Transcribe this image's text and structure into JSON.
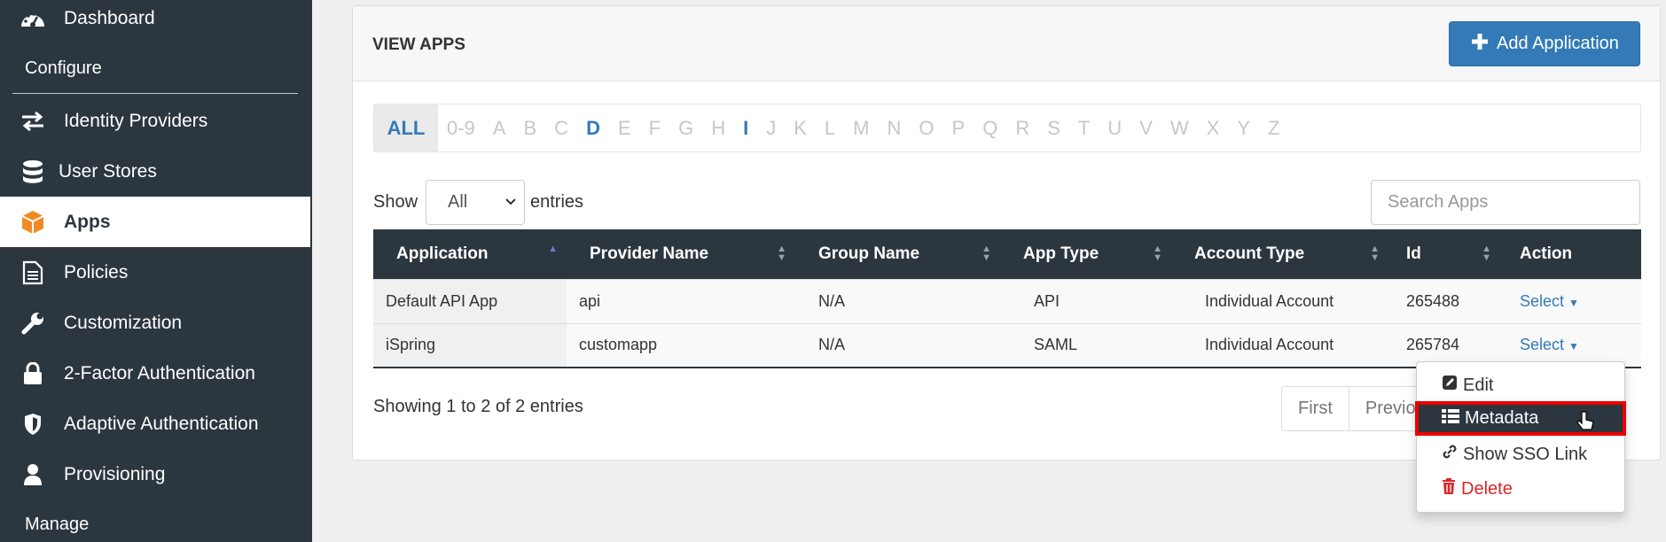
{
  "sidebar": {
    "items": [
      {
        "label": "Dashboard",
        "icon": "dashboard-icon"
      },
      {
        "label": "Identity Providers",
        "icon": "exchange-icon"
      },
      {
        "label": "User Stores",
        "icon": "database-icon"
      },
      {
        "label": "Apps",
        "icon": "cube-icon",
        "active": true
      },
      {
        "label": "Policies",
        "icon": "document-icon"
      },
      {
        "label": "Customization",
        "icon": "wrench-icon"
      },
      {
        "label": "2-Factor Authentication",
        "icon": "lock-icon"
      },
      {
        "label": "Adaptive Authentication",
        "icon": "shield-icon"
      },
      {
        "label": "Provisioning",
        "icon": "user-icon"
      }
    ],
    "sections": {
      "configure": "Configure",
      "manage": "Manage"
    }
  },
  "panel": {
    "title": "VIEW APPS",
    "add_button": "Add Application"
  },
  "alphabet": {
    "items": [
      "ALL",
      "0-9",
      "A",
      "B",
      "C",
      "D",
      "E",
      "F",
      "G",
      "H",
      "I",
      "J",
      "K",
      "L",
      "M",
      "N",
      "O",
      "P",
      "Q",
      "R",
      "S",
      "T",
      "U",
      "V",
      "W",
      "X",
      "Y",
      "Z"
    ],
    "selected": "ALL",
    "with_entries": [
      "D",
      "I"
    ]
  },
  "controls": {
    "show_label": "Show",
    "length_value": "All",
    "entries_label": "entries",
    "search_placeholder": "Search Apps"
  },
  "table": {
    "columns": [
      "Application",
      "Provider Name",
      "Group Name",
      "App Type",
      "Account Type",
      "Id",
      "Action"
    ],
    "rows": [
      {
        "application": "Default API App",
        "provider": "api",
        "group": "N/A",
        "type": "API",
        "account": "Individual Account",
        "id": "265488",
        "action": "Select"
      },
      {
        "application": "iSpring",
        "provider": "customapp",
        "group": "N/A",
        "type": "SAML",
        "account": "Individual Account",
        "id": "265784",
        "action": "Select"
      }
    ]
  },
  "footer": {
    "info": "Showing 1 to 2 of 2 entries",
    "pager": [
      "First",
      "Previous"
    ]
  },
  "action_menu": {
    "items": [
      "Edit",
      "Metadata",
      "Show SSO Link",
      "Delete"
    ],
    "highlighted": "Metadata"
  },
  "colors": {
    "sidebar": "#2c363f",
    "accent": "#337ab7",
    "danger": "#d9262a",
    "highlight_border": "#ee0000"
  }
}
